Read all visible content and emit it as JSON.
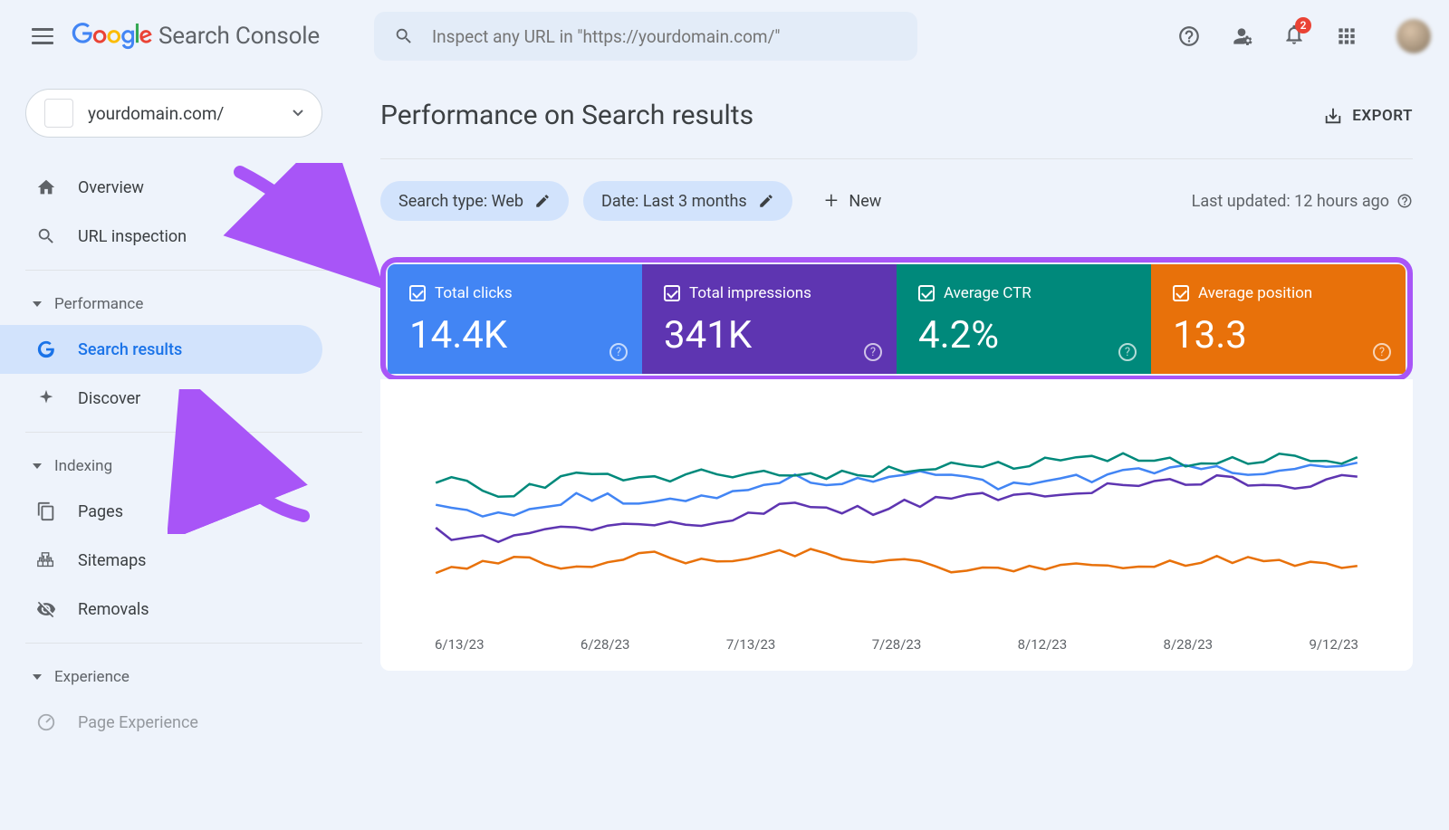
{
  "header": {
    "product": "Search Console",
    "search_placeholder": "Inspect any URL in \"https://yourdomain.com/\"",
    "notification_count": "2"
  },
  "sidebar": {
    "property_name": "yourdomain.com/",
    "items": {
      "overview": "Overview",
      "url_inspection": "URL inspection",
      "search_results": "Search results",
      "discover": "Discover",
      "pages": "Pages",
      "sitemaps": "Sitemaps",
      "removals": "Removals",
      "page_experience": "Page Experience"
    },
    "sections": {
      "performance": "Performance",
      "indexing": "Indexing",
      "experience": "Experience"
    }
  },
  "main": {
    "title": "Performance on Search results",
    "export": "EXPORT",
    "filters": {
      "search_type": "Search type: Web",
      "date": "Date: Last 3 months",
      "new": "New"
    },
    "last_updated": "Last updated: 12 hours ago",
    "metrics": {
      "clicks_label": "Total clicks",
      "clicks_value": "14.4K",
      "impressions_label": "Total impressions",
      "impressions_value": "341K",
      "ctr_label": "Average CTR",
      "ctr_value": "4.2%",
      "position_label": "Average position",
      "position_value": "13.3"
    },
    "xaxis": [
      "6/13/23",
      "6/28/23",
      "7/13/23",
      "7/28/23",
      "8/12/23",
      "8/28/23",
      "9/12/23"
    ]
  },
  "chart_data": {
    "type": "line",
    "x": [
      "6/13/23",
      "6/28/23",
      "7/13/23",
      "7/28/23",
      "8/12/23",
      "8/28/23",
      "9/12/23"
    ],
    "note": "Values are approximate readings from rendered chart; y-axis not labeled in screenshot.",
    "series": [
      {
        "name": "Total clicks",
        "color": "#4285f4",
        "values_rel": [
          0.55,
          0.5,
          0.6,
          0.58,
          0.62,
          0.7,
          0.68,
          0.72,
          0.65,
          0.7,
          0.74,
          0.76,
          0.72,
          0.8
        ]
      },
      {
        "name": "Total impressions",
        "color": "#5e35b1",
        "values_rel": [
          0.4,
          0.35,
          0.45,
          0.42,
          0.48,
          0.55,
          0.52,
          0.58,
          0.6,
          0.62,
          0.68,
          0.7,
          0.66,
          0.72
        ]
      },
      {
        "name": "Average CTR",
        "color": "#00897b",
        "values_rel": [
          0.7,
          0.62,
          0.72,
          0.68,
          0.74,
          0.7,
          0.73,
          0.76,
          0.78,
          0.8,
          0.82,
          0.78,
          0.84,
          0.8
        ]
      },
      {
        "name": "Average position",
        "color": "#e8710a",
        "values_rel": [
          0.2,
          0.25,
          0.22,
          0.28,
          0.24,
          0.3,
          0.26,
          0.22,
          0.18,
          0.24,
          0.2,
          0.26,
          0.22,
          0.24
        ]
      }
    ]
  }
}
